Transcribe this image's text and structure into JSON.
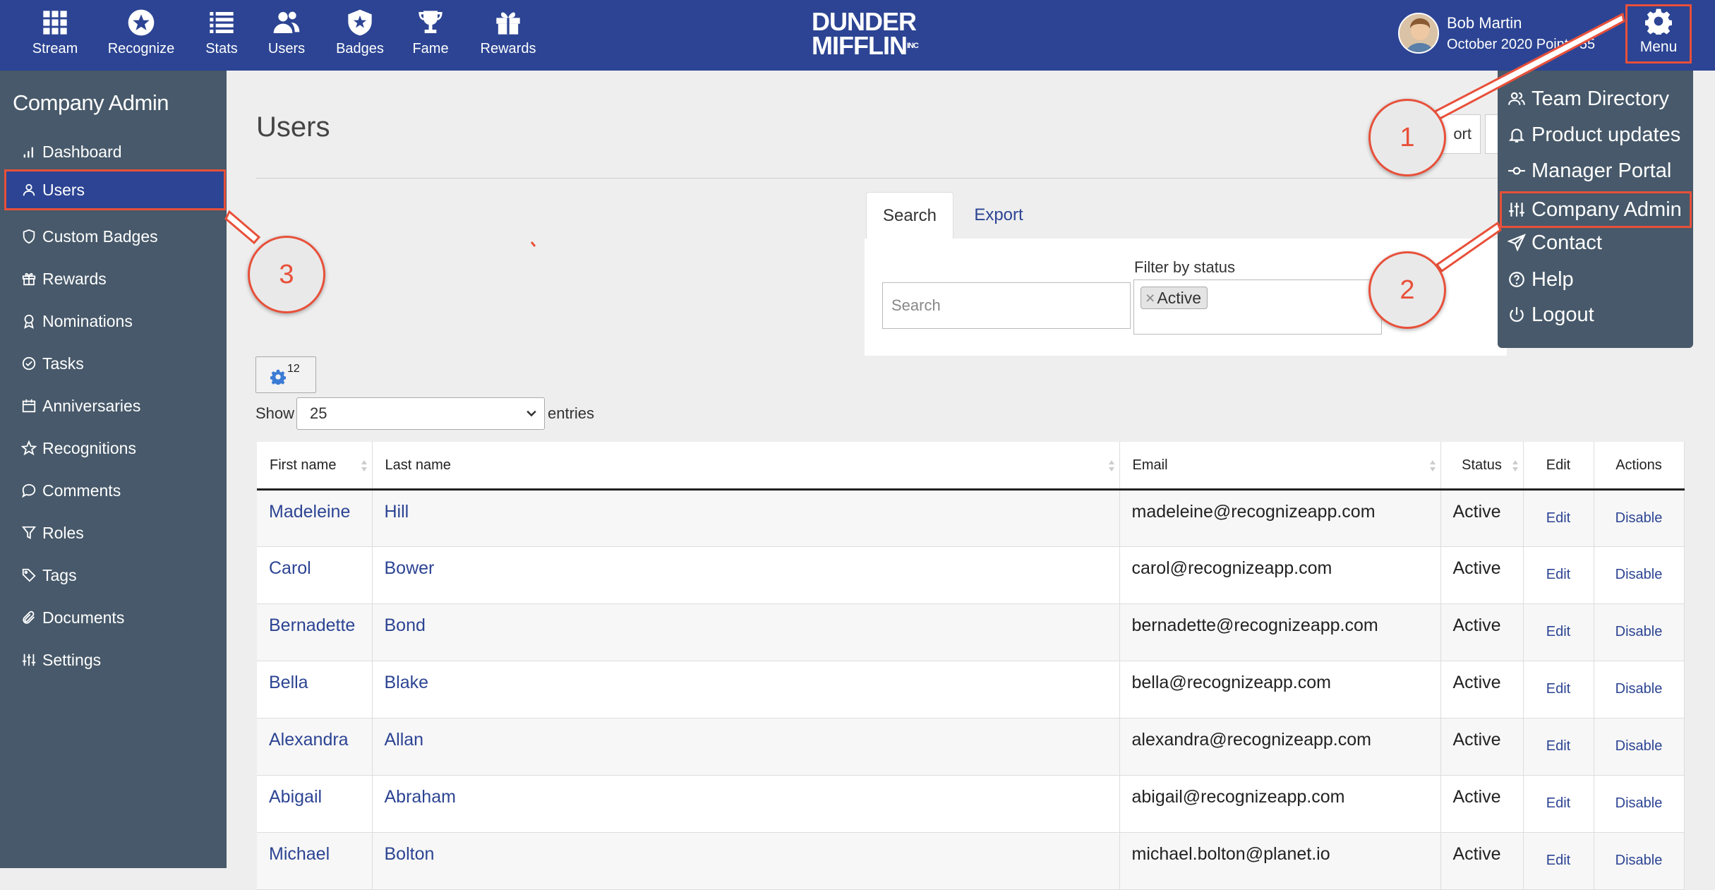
{
  "topbar": {
    "nav": [
      {
        "label": "Stream",
        "icon": "grid-icon"
      },
      {
        "label": "Recognize",
        "icon": "star-badge-icon"
      },
      {
        "label": "Stats",
        "icon": "list-icon"
      },
      {
        "label": "Users",
        "icon": "users-icon"
      },
      {
        "label": "Badges",
        "icon": "shield-icon"
      },
      {
        "label": "Fame",
        "icon": "trophy-icon"
      },
      {
        "label": "Rewards",
        "icon": "gift-icon"
      }
    ],
    "logo_line1": "DUNDER",
    "logo_line2": "MIFFLIN",
    "logo_inc": "INC",
    "user_name": "Bob Martin",
    "user_points": "October 2020 Points 55",
    "menu_label": "Menu"
  },
  "sidebar": {
    "title": "Company Admin",
    "items": [
      {
        "label": "Dashboard",
        "icon": "bar-chart-icon"
      },
      {
        "label": "Users",
        "icon": "user-icon",
        "active": true
      },
      {
        "label": "Custom Badges",
        "icon": "shield-outline-icon"
      },
      {
        "label": "Rewards",
        "icon": "gift-outline-icon"
      },
      {
        "label": "Nominations",
        "icon": "award-icon"
      },
      {
        "label": "Tasks",
        "icon": "check-circle-icon"
      },
      {
        "label": "Anniversaries",
        "icon": "calendar-icon"
      },
      {
        "label": "Recognitions",
        "icon": "star-outline-icon"
      },
      {
        "label": "Comments",
        "icon": "comment-icon"
      },
      {
        "label": "Roles",
        "icon": "filter-icon"
      },
      {
        "label": "Tags",
        "icon": "tag-icon"
      },
      {
        "label": "Documents",
        "icon": "paperclip-icon"
      },
      {
        "label": "Settings",
        "icon": "sliders-icon"
      }
    ]
  },
  "main": {
    "title": "Users",
    "header_button_partial": "ort",
    "tabs": [
      {
        "label": "Search"
      },
      {
        "label": "Export"
      }
    ],
    "search_placeholder": "Search",
    "filter_label": "Filter by status",
    "filter_chip_x": "×",
    "filter_chip": "Active",
    "columns_count": "12",
    "show_label": "Show",
    "show_value": "25",
    "entries_label": "entries"
  },
  "table": {
    "headers": [
      "First name",
      "Last name",
      "Email",
      "Status",
      "Edit",
      "Actions"
    ],
    "rows": [
      {
        "first": "Madeleine",
        "last": "Hill",
        "email": "madeleine@recognizeapp.com",
        "status": "Active",
        "edit": "Edit",
        "action": "Disable"
      },
      {
        "first": "Carol",
        "last": "Bower",
        "email": "carol@recognizeapp.com",
        "status": "Active",
        "edit": "Edit",
        "action": "Disable"
      },
      {
        "first": "Bernadette",
        "last": "Bond",
        "email": "bernadette@recognizeapp.com",
        "status": "Active",
        "edit": "Edit",
        "action": "Disable"
      },
      {
        "first": "Bella",
        "last": "Blake",
        "email": "bella@recognizeapp.com",
        "status": "Active",
        "edit": "Edit",
        "action": "Disable"
      },
      {
        "first": "Alexandra",
        "last": "Allan",
        "email": "alexandra@recognizeapp.com",
        "status": "Active",
        "edit": "Edit",
        "action": "Disable"
      },
      {
        "first": "Abigail",
        "last": "Abraham",
        "email": "abigail@recognizeapp.com",
        "status": "Active",
        "edit": "Edit",
        "action": "Disable"
      },
      {
        "first": "Michael",
        "last": "Bolton",
        "email": "michael.bolton@planet.io",
        "status": "Active",
        "edit": "Edit",
        "action": "Disable"
      }
    ]
  },
  "menu_dropdown": {
    "items": [
      {
        "label": "Team Directory",
        "icon": "team-icon"
      },
      {
        "label": "Product updates",
        "icon": "bell-icon"
      },
      {
        "label": "Manager Portal",
        "icon": "commit-icon"
      },
      {
        "label": "Company Admin",
        "icon": "sliders-icon",
        "highlighted": true
      },
      {
        "label": "Contact",
        "icon": "send-icon"
      },
      {
        "label": "Help",
        "icon": "question-circle-icon"
      },
      {
        "label": "Logout",
        "icon": "power-icon"
      }
    ]
  },
  "annotations": {
    "step1": "1",
    "step2": "2",
    "step3": "3",
    "color": "#e8503a"
  },
  "colors": {
    "brand": "#2c4493",
    "sidebar": "#47596a",
    "highlight": "#e8503a"
  }
}
